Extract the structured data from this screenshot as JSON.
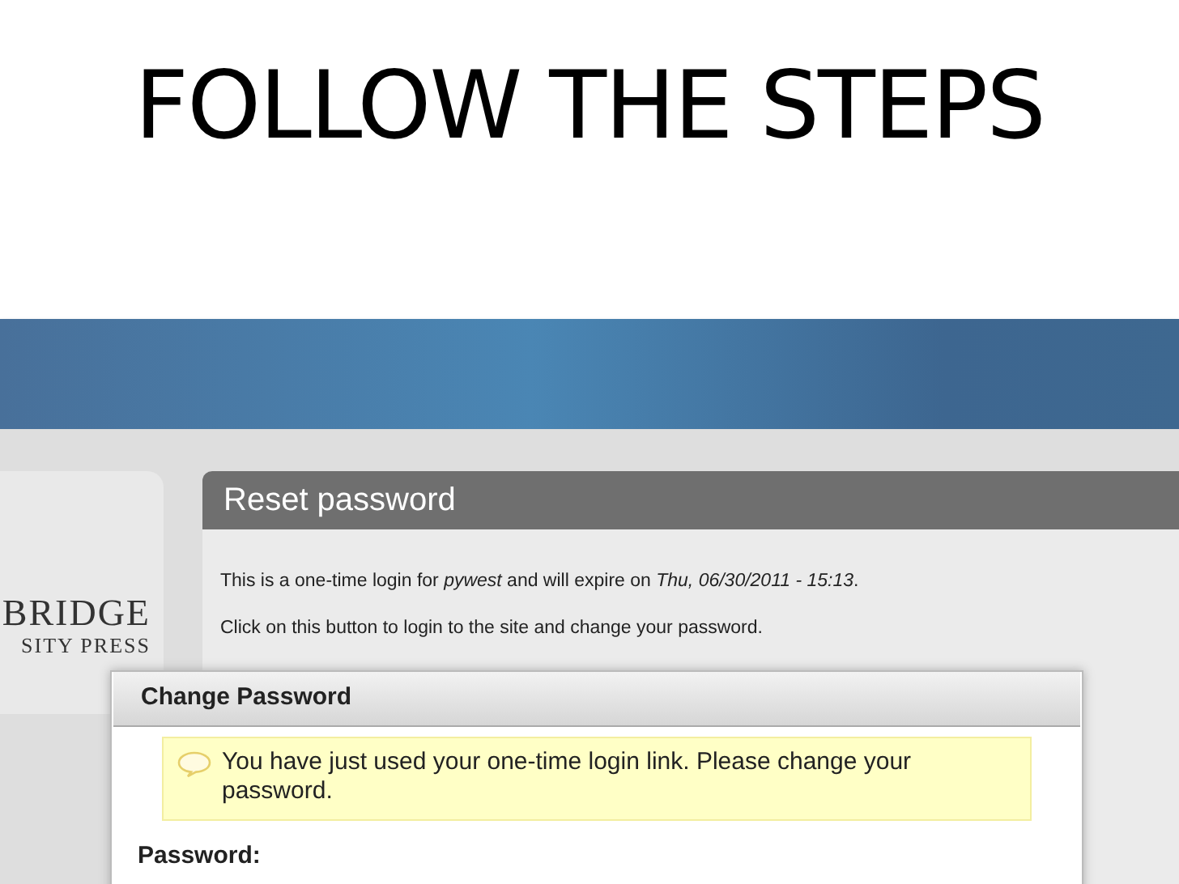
{
  "slide_title": "FOLLOW THE STEPS",
  "logo": {
    "line_1": "BRIDGE",
    "line_2": "SITY PRESS"
  },
  "reset_panel": {
    "title": "Reset password",
    "intro_parts": [
      "This is a one-time login for ",
      "pywest",
      " and will expire on ",
      "Thu, 06/30/2011 - 15:13",
      "."
    ],
    "instruction": "Click on this button to login to the site and change your password."
  },
  "dialog": {
    "title": "Change Password",
    "message": "You have just used your one-time login link. Please change your password.",
    "field_label": "Password:"
  }
}
